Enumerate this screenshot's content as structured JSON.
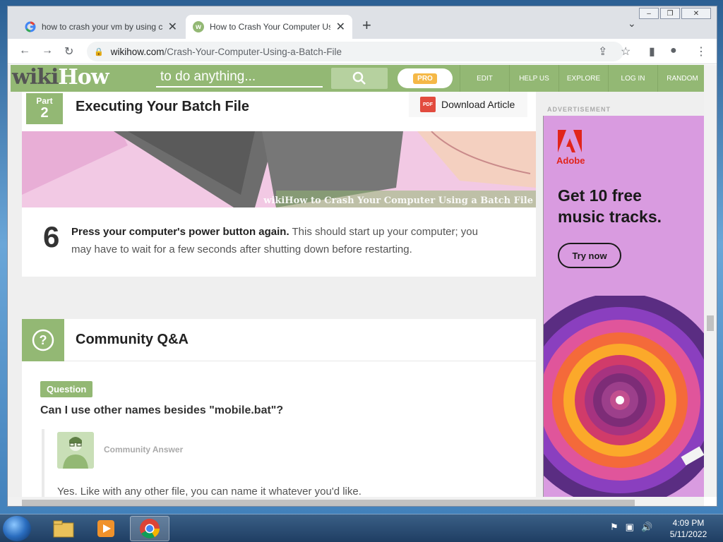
{
  "browser": {
    "tabs": [
      {
        "title": "how to crash your vm by using c",
        "active": false
      },
      {
        "title": "How to Crash Your Computer Usi",
        "active": true
      }
    ],
    "url_host": "wikihow.com",
    "url_path": "/Crash-Your-Computer-Using-a-Batch-File"
  },
  "wikihow": {
    "logo_wiki": "wiki",
    "logo_how": "How",
    "search_placeholder": "to do anything...",
    "pro_label": "PRO",
    "nav": [
      "EDIT",
      "HELP US",
      "EXPLORE",
      "LOG IN",
      "RANDOM"
    ]
  },
  "article": {
    "part_label": "Part",
    "part_number": "2",
    "part_title": "Executing Your Batch File",
    "download_label": "Download Article",
    "pdf_icon_text": "PDF",
    "image_watermark": "wikiHow to Crash Your Computer Using a Batch File",
    "step_number": "6",
    "step_bold": "Press your computer's power button again.",
    "step_text": " This should start up your computer; you may have to wait for a few seconds after shutting down before restarting."
  },
  "qa": {
    "title": "Community Q&A",
    "question_badge": "Question",
    "question": "Can I use other names besides \"mobile.bat\"?",
    "answer_by": "Community Answer",
    "answer": "Yes. Like with any other file, you can name it whatever you'd like."
  },
  "ad": {
    "label": "ADVERTISEMENT",
    "brand": "Adobe",
    "headline_line1": "Get 10 free",
    "headline_line2": "music tracks.",
    "cta": "Try now"
  },
  "taskbar": {
    "time": "4:09 PM",
    "date": "5/11/2022"
  },
  "colors": {
    "wikihow_green": "#93b874",
    "adobe_red": "#e1251b",
    "ad_bg": "#d99be0"
  }
}
